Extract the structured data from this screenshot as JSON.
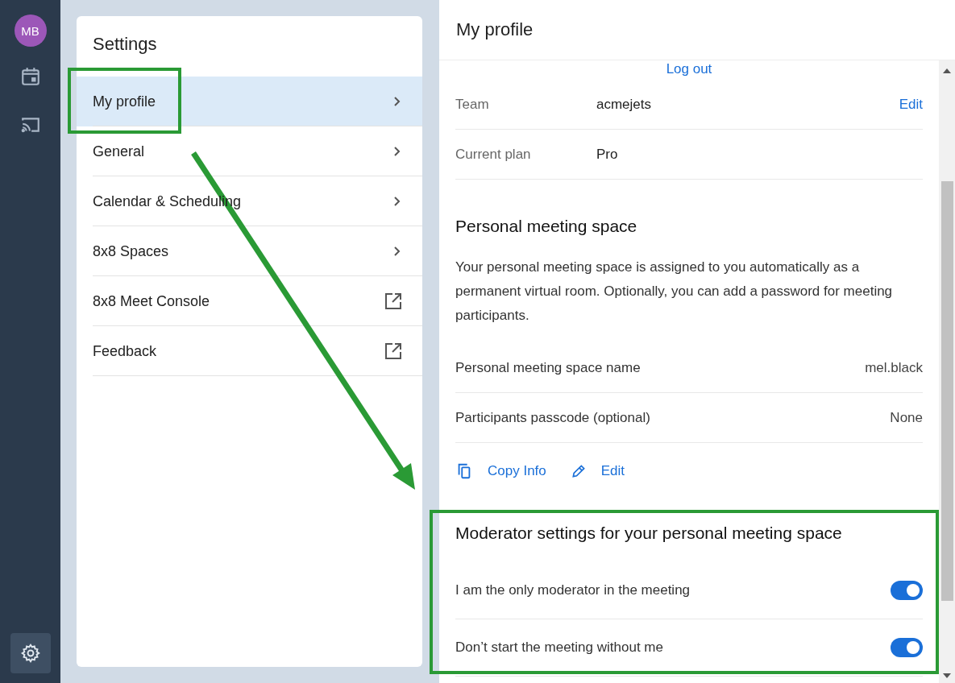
{
  "rail": {
    "avatar": "MB",
    "items": [
      {
        "kind": "calendar",
        "selected": false
      },
      {
        "kind": "cast",
        "selected": false
      },
      {
        "kind": "settings",
        "selected": true
      }
    ]
  },
  "settings_menu": {
    "title": "Settings",
    "items": [
      {
        "label": "My profile",
        "kind": "chevron",
        "selected": true
      },
      {
        "label": "General",
        "kind": "chevron",
        "selected": false
      },
      {
        "label": "Calendar & Scheduling",
        "kind": "chevron",
        "selected": false
      },
      {
        "label": "8x8 Spaces",
        "kind": "chevron",
        "selected": false
      },
      {
        "label": "8x8 Meet Console",
        "kind": "external",
        "selected": false
      },
      {
        "label": "Feedback",
        "kind": "external",
        "selected": false
      }
    ]
  },
  "profile": {
    "title": "My profile",
    "logout": "Log out",
    "rows": [
      {
        "label": "Team",
        "value": "acmejets",
        "action": "Edit"
      },
      {
        "label": "Current plan",
        "value": "Pro"
      }
    ],
    "meeting_space": {
      "heading": "Personal meeting space",
      "description": "Your personal meeting space is assigned to you automatically as a permanent virtual room. Optionally, you can add a password for meeting participants.",
      "rows": [
        {
          "label": "Personal meeting space name",
          "value": "mel.black"
        },
        {
          "label": "Participants passcode (optional)",
          "value": "None"
        }
      ],
      "actions": [
        {
          "kind": "copy",
          "label": "Copy Info"
        },
        {
          "kind": "edit",
          "label": "Edit"
        }
      ]
    },
    "moderator": {
      "heading": "Moderator settings for your personal meeting space",
      "toggles": [
        {
          "label": "I am the only moderator in the meeting",
          "on": true
        },
        {
          "label": "Don’t start the meeting without me",
          "on": true
        }
      ]
    }
  }
}
